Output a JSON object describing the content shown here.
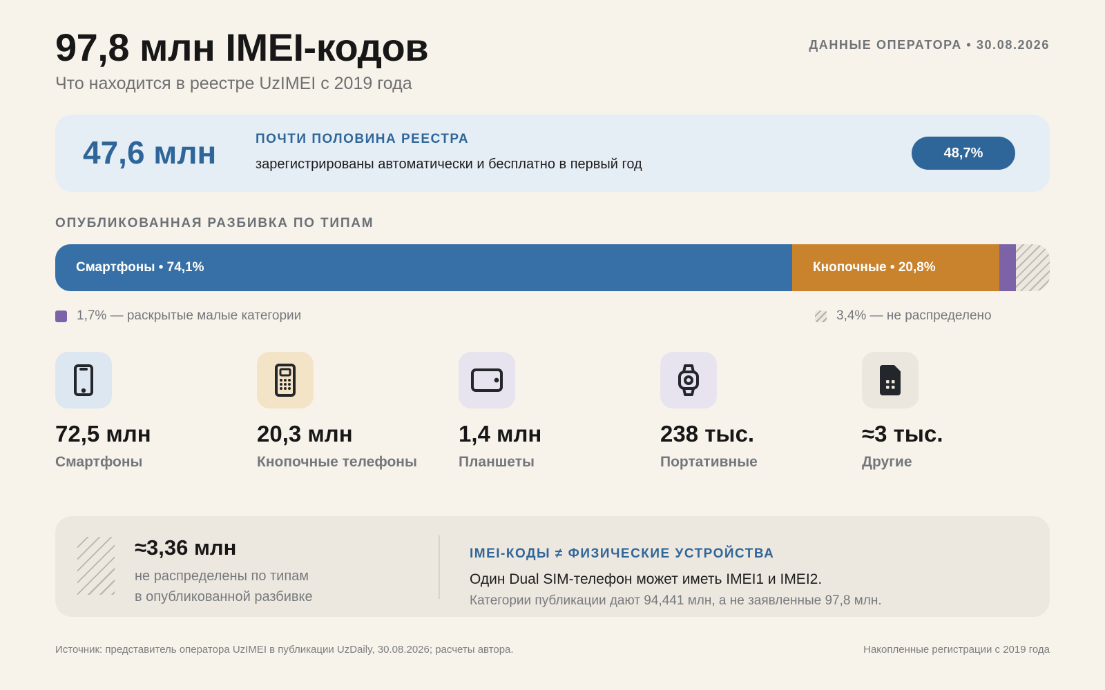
{
  "header": {
    "title": "97,8 млн IMEI-кодов",
    "subtitle": "Что находится в реестре UzIMEI с 2019 года",
    "meta": "ДАННЫЕ ОПЕРАТОРА • 30.08.2026"
  },
  "hero": {
    "number": "47,6 млн",
    "label": "ПОЧТИ ПОЛОВИНА РЕЕСТРА",
    "text": "зарегистрированы автоматически и бесплатно в первый год",
    "badge": "48,7%"
  },
  "breakdown": {
    "label": "ОПУБЛИКОВАННАЯ РАЗБИВКА ПО ТИПАМ",
    "segments": [
      {
        "key": "smartphones",
        "percent": 74.1,
        "label": "Смартфоны • 74,1%",
        "color": "#3670a6"
      },
      {
        "key": "feature",
        "percent": 20.8,
        "label": "Кнопочные • 20,8%",
        "color": "#c9832d"
      },
      {
        "key": "small",
        "percent": 1.7,
        "label": "",
        "color": "#7c63a8"
      },
      {
        "key": "unallocated",
        "percent": 3.4,
        "label": "",
        "color": "hatched"
      }
    ],
    "legend_small": "1,7% — раскрытые малые категории",
    "legend_unallocated": "3,4% — не распределено"
  },
  "categories": [
    {
      "icon": "smartphone-icon",
      "value": "72,5 млн",
      "label": "Смартфоны",
      "bg": "#dde7f1"
    },
    {
      "icon": "feature-phone-icon",
      "value": "20,3 млн",
      "label": "Кнопочные телефоны",
      "bg": "#f4e4c7"
    },
    {
      "icon": "tablet-icon",
      "value": "1,4 млн",
      "label": "Планшеты",
      "bg": "#e8e4ef"
    },
    {
      "icon": "smartwatch-icon",
      "value": "238 тыс.",
      "label": "Портативные",
      "bg": "#e8e4ef"
    },
    {
      "icon": "sim-card-icon",
      "value": "≈3 тыс.",
      "label": "Другие",
      "bg": "#ebe7df"
    }
  ],
  "bottom": {
    "value": "≈3,36 млн",
    "note_line1": "не распределены по типам",
    "note_line2": "в опубликованной разбивке",
    "heading": "IMEI-КОДЫ ≠ ФИЗИЧЕСКИЕ УСТРОЙСТВА",
    "line1": "Один Dual SIM-телефон может иметь IMEI1 и IMEI2.",
    "line2": "Категории публикации дают 94,441 млн, а не заявленные 97,8 млн."
  },
  "footer": {
    "source": "Источник: представитель оператора UzIMEI в публикации UzDaily, 30.08.2026; расчеты автора.",
    "note": "Накопленные регистрации с 2019 года"
  }
}
